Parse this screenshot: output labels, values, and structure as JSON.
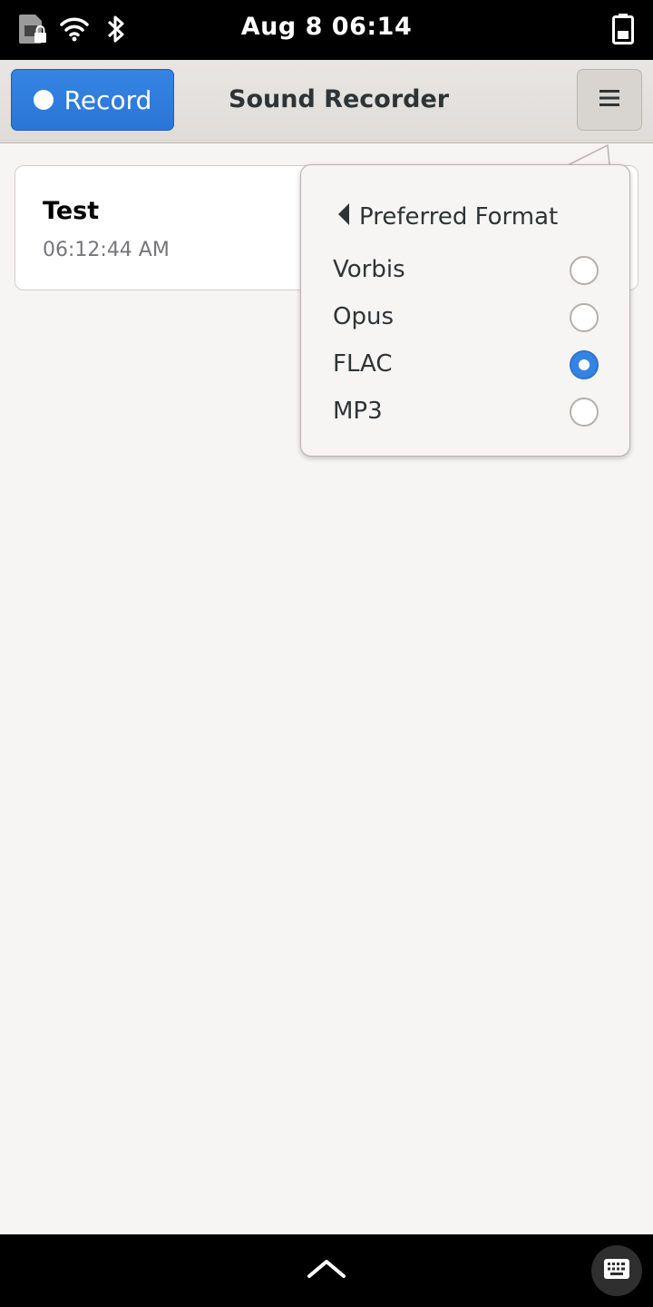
{
  "status_bar": {
    "clock": "Aug 8  06:14",
    "icons": [
      "sim-locked-icon",
      "wifi-icon",
      "bluetooth-icon",
      "battery-icon"
    ]
  },
  "header": {
    "record_label": "Record",
    "title": "Sound Recorder",
    "menu_icon": "hamburger-menu-icon"
  },
  "recordings": [
    {
      "name": "Test",
      "time": "06:12:44 AM"
    }
  ],
  "popover": {
    "title": "Preferred Format",
    "back_icon": "back-triangle-icon",
    "options": [
      {
        "label": "Vorbis",
        "checked": false
      },
      {
        "label": "Opus",
        "checked": false
      },
      {
        "label": "FLAC",
        "checked": true
      },
      {
        "label": "MP3",
        "checked": false
      }
    ]
  },
  "bottom_bar": {
    "icons": [
      "chevron-up-icon",
      "keyboard-icon"
    ]
  },
  "colors": {
    "accent": "#3584e4",
    "background": "#f6f5f4",
    "statusbar": "#000000"
  }
}
